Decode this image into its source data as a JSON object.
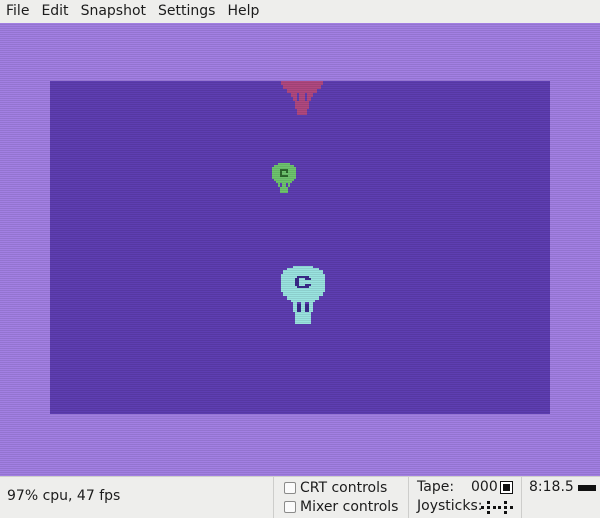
{
  "menu": {
    "file": "File",
    "edit": "Edit",
    "snapshot": "Snapshot",
    "settings": "Settings",
    "help": "Help"
  },
  "display": {
    "border_color": "#a27fe3",
    "screen_color": "#5e3eb2",
    "sprites": [
      {
        "name": "balloon-red",
        "color": "#b04880"
      },
      {
        "name": "balloon-green",
        "color": "#6ec46e"
      },
      {
        "name": "balloon-cyan",
        "color": "#9ae3e0"
      }
    ]
  },
  "status": {
    "performance": "97% cpu, 47 fps",
    "crt_controls": "CRT controls",
    "mixer_controls": "Mixer controls",
    "tape_label": "Tape:",
    "tape_counter": "000",
    "tape_state_icon": "stop-icon",
    "joysticks_label": "Joysticks:",
    "joystick_icons": [
      "joystick-port-1-icon",
      "joystick-port-2-icon"
    ],
    "time": "8:18.5"
  }
}
